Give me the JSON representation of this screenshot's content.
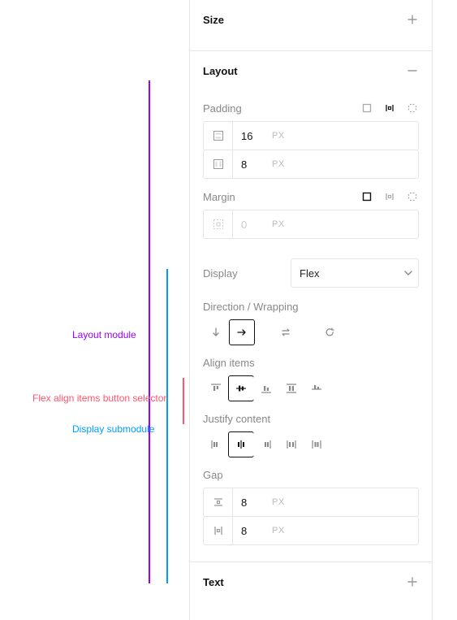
{
  "annotations": {
    "layout_module": "Layout module",
    "display_submodule": "Display submodule",
    "align_items_selector": "Flex align items button selector"
  },
  "sections": {
    "size": {
      "title": "Size"
    },
    "layout": {
      "title": "Layout",
      "padding": {
        "label": "Padding",
        "v_value": "16",
        "h_value": "8",
        "unit": "PX"
      },
      "margin": {
        "label": "Margin",
        "value": "0",
        "unit": "PX"
      },
      "display": {
        "label": "Display",
        "value": "Flex"
      },
      "direction": {
        "label": "Direction / Wrapping"
      },
      "align_items": {
        "label": "Align items"
      },
      "justify_content": {
        "label": "Justify content"
      },
      "gap": {
        "label": "Gap",
        "row_value": "8",
        "col_value": "8",
        "unit": "PX"
      }
    },
    "text": {
      "title": "Text"
    }
  }
}
